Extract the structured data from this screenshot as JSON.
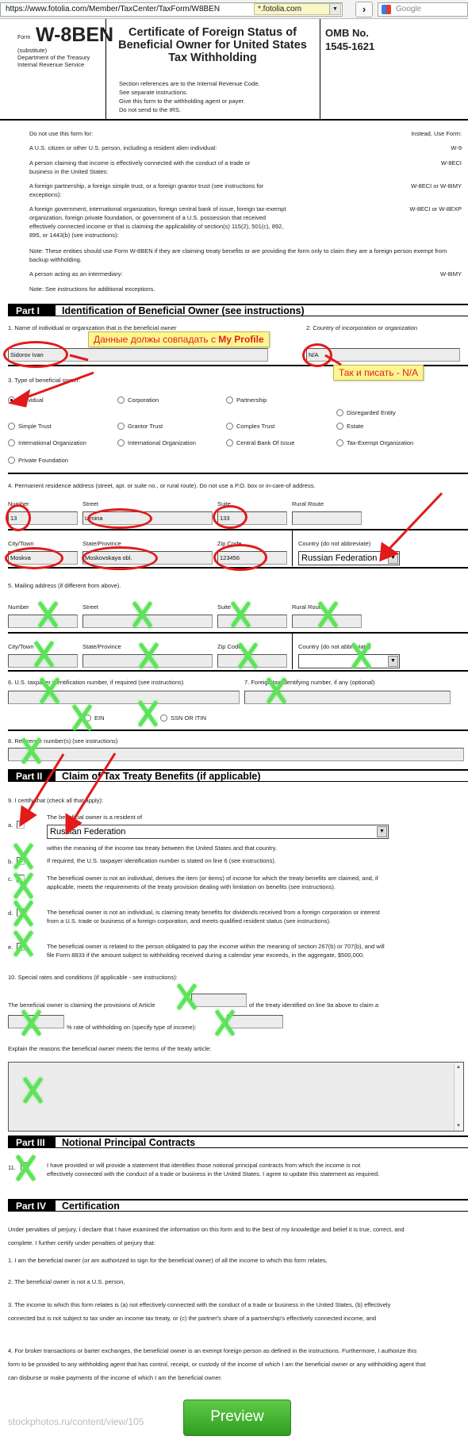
{
  "browser": {
    "url": "https://www.fotolia.com/Member/TaxCenter/TaxForm/W8BEN",
    "site_badge": "*.fotolia.com",
    "go_icon": "chevron-right-icon",
    "search_placeholder": "Google"
  },
  "header": {
    "form_label": "Form",
    "form_number": "W-8BEN",
    "substitute": "(substitute)",
    "department": "Department of the Treasury",
    "irs": "Internal Revenue Service",
    "title": "Certificate of Foreign Status of Beneficial Owner for United States Tax Withholding",
    "references": [
      "Section references are to the Internal Revenue Code.",
      "See separate instructions.",
      "Give this form to the withholding agent or payer.",
      "Do not send to the IRS."
    ],
    "omb_label": "OMB No.",
    "omb_number": "1545-1621"
  },
  "exclusions": {
    "left_header": "Do not use this form for:",
    "right_header": "Instead, Use Form:",
    "rows": [
      {
        "text": "A U.S. citizen or other U.S. person, including a resident alien individual:",
        "form": "W-9"
      },
      {
        "text": "A person claiming that income is effectively connected with the conduct of a trade or business in the United States:",
        "form": "W-8ECI"
      },
      {
        "text": "A foreign partnership, a foreign simple trust, or a foreign grantor trust (see instructions for exceptions):",
        "form": "W-8ECI or W-8IMY"
      },
      {
        "text": "A foreign government, international organization, foreign central bank of issue, foreign tax-exempt organization, foreign private foundation, or government of a U.S. possession that received effectively connected income or that is claiming the applicability of section(s) 115(2), 501(c), 892, 895, or 1443(b) (see instructions):",
        "form": "W-8ECI or W-8EXP"
      }
    ],
    "note1": "Note: These entities should use Form W-8BEN if they are claiming treaty benefits or are providing the form only to claim they are a foreign person exempt from backup withholding.",
    "intermediary": {
      "text": "A person acting as an intermediary:",
      "form": "W-8IMY"
    },
    "note2": "Note: See instructions for additional exceptions."
  },
  "part1": {
    "tag": "Part I",
    "title": "Identification of Beneficial Owner (see instructions)",
    "q1_label": "1. Name of individual or organization that is the beneficial owner",
    "q1_value": "Sidorov Ivan",
    "q2_label": "2. Country of incorporation or organization",
    "q2_value": "N/A",
    "q3_label": "3. Type of beneficial owner:",
    "owner_types": [
      {
        "label": "Individual",
        "selected": true
      },
      {
        "label": "Corporation",
        "selected": false
      },
      {
        "label": "Partnership",
        "selected": false
      },
      {
        "label": "Disregarded Entity",
        "selected": false
      },
      {
        "label": "Simple Trust",
        "selected": false
      },
      {
        "label": "Grantor Trust",
        "selected": false
      },
      {
        "label": "Complex Trust",
        "selected": false
      },
      {
        "label": "Estate",
        "selected": false
      },
      {
        "label": "International Organization",
        "selected": false
      },
      {
        "label": "International Organization",
        "selected": false
      },
      {
        "label": "Central Bank Of Issue",
        "selected": false
      },
      {
        "label": "Tax-Exempt Organization",
        "selected": false
      },
      {
        "label": "Private Foundation",
        "selected": false
      }
    ],
    "q4_label": "4. Permanent residence address (street, apt. or suite no., or rural route). Do not use a P.O. box or in-care-of address.",
    "address": {
      "number_label": "Number",
      "number": "13",
      "street_label": "Street",
      "street": "Lenina",
      "suite_label": "Suite",
      "suite": "133",
      "rural_label": "Rural Route",
      "rural": "",
      "city_label": "City/Town",
      "city": "Moskva",
      "state_label": "State/Province",
      "state": "Moskovskaya obl.",
      "zip_label": "Zip Code",
      "zip": "123456",
      "country_label": "Country (do not abbreviate)",
      "country": "Russian Federation"
    },
    "q5_label": "5. Mailing address (if different from above).",
    "mailing": {
      "number_label": "Number",
      "street_label": "Street",
      "suite_label": "Suite",
      "rural_label": "Rural Route",
      "city_label": "City/Town",
      "state_label": "State/Province",
      "zip_label": "Zip Code",
      "country_label": "Country (do not abbreviate)",
      "number": "",
      "street": "",
      "suite": "",
      "rural": "",
      "city": "",
      "state": "",
      "zip": "",
      "country": ""
    },
    "q6_label": "6. U.S. taxpayer identification number, if required (see instructions)",
    "q6_value": "",
    "ein_label": "EIN",
    "ssn_label": "SSN OR ITIN",
    "q7_label": "7. Foreign tax identifying number, if any (optional)",
    "q7_value": "",
    "q8_label": "8. Reference number(s) (see instructions)",
    "q8_value": ""
  },
  "part2": {
    "tag": "Part II",
    "title": "Claim of Tax Treaty Benefits (if applicable)",
    "q9_label": "9. I certify that (check all that apply):",
    "a_letter": "a.",
    "a_text": "The beneficial owner is a resident of",
    "a_country": "Russian Federation",
    "a_text2": "within the meaning of the income tax treaty between the United States and that country.",
    "a_checked": true,
    "items": [
      {
        "letter": "b.",
        "text": "If required, the U.S. taxpayer identification number is stated on line 6 (see instructions).",
        "checked": false
      },
      {
        "letter": "c.",
        "text": "The beneficial owner is not an individual, derives the item (or items) of income for which the treaty benefits are claimed, and, if applicable, meets the requirements of the treaty provision dealing with limitation on benefits (see instructions).",
        "checked": false
      },
      {
        "letter": "d.",
        "text": "The beneficial owner is not an individual, is claiming treaty benefits for dividends received from a foreign corporation or interest from a U.S. trade or business of a foreign corporation, and meets qualified resident status (see instructions).",
        "checked": false
      },
      {
        "letter": "e.",
        "text": "The beneficial owner is related to the person obligated to pay the income within the meaning of section 267(b) or 707(b), and will file Form 8833 if the amount subject to withholding received during a calendar year exceeds, in the aggregate, $500,000.",
        "checked": false
      }
    ],
    "q10_label": "10. Special rates and conditions (if applicable - see instructions):",
    "q10_text1": "The beneficial owner is claiming the provisions of Article",
    "q10_text2": "of the treaty identified on line 9a above to claim a",
    "q10_text3": "% rate of withholding on (specify type of income):",
    "article": "",
    "rate": "",
    "income_type": "",
    "explain_label": "Explain the reasons the beneficial owner meets the terms of the treaty article:",
    "explain_value": ""
  },
  "part3": {
    "tag": "Part III",
    "title": "Notional Principal Contracts",
    "q11_num": "11.",
    "q11_text": "I have provided or will provide a statement that identifies those notional principal contracts from which the income is not effectively connected with the conduct of a trade or business in the United States. I agree to update this statement as required.",
    "q11_checked": false
  },
  "part4": {
    "tag": "Part IV",
    "title": "Certification",
    "intro": "Under penalties of perjury, I declare that I have examined the information on this form and to the best of my knowledge and belief it is true, correct, and complete. I further certify under penalties of perjury that:",
    "p1": "1. I am the beneficial owner (or am authorized to sign for the beneficial owner) of all the income to which this form relates,",
    "p2": "2. The beneficial owner is not a U.S. person,",
    "p3": "3. The income to which this form relates is (a) not effectively connected with the conduct of a trade or business in the United States, (b) effectively connected but is not subject to tax under an income tax treaty, or (c) the partner's share of a partnership's effectively connected income, and",
    "p4": "4. For broker transactions or barter exchanges, the beneficial owner is an exempt foreign person as defined in the instructions. Furthermore, I authorize this form to be provided to any withholding agent that has control, receipt, or custody of the income of which I am the beneficial owner or any withholding agent that can disburse or make payments of the income of which I am the beneficial owner."
  },
  "preview_button": "Preview",
  "annotations": {
    "callout1_prefix": "Данные должы совпадать с ",
    "callout1_bold": "My Profile",
    "callout2": "Так и писать - N/A",
    "watermark": "stockphotos.ru/content/view/105",
    "ellipse_color": "#e21a1a",
    "xmark_color": "#5ee35a"
  }
}
